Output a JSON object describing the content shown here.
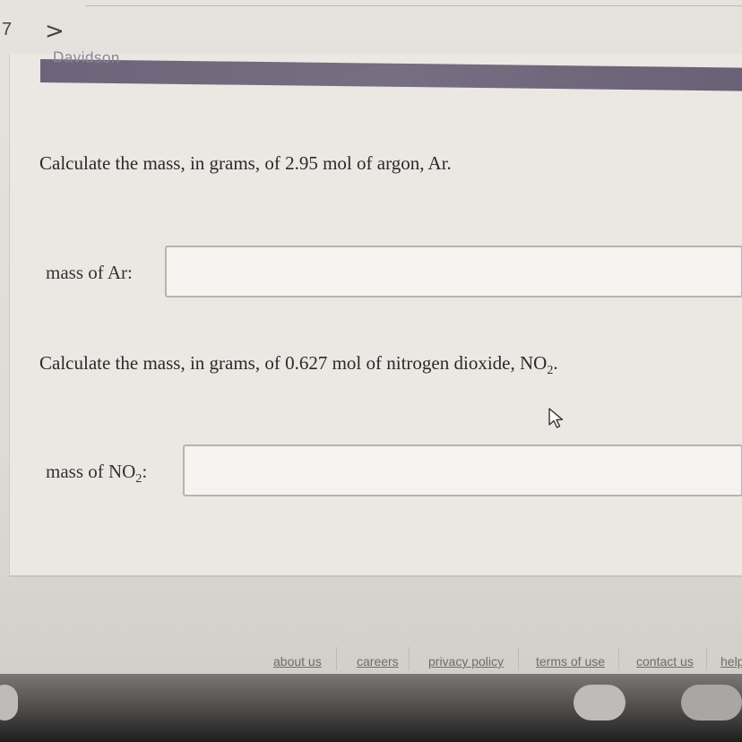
{
  "nav": {
    "question_number": "7",
    "next_arrow": ">"
  },
  "banner": {
    "label": "Davidson"
  },
  "questions": [
    {
      "prompt": "Calculate the mass, in grams, of 2.95 mol of argon, Ar.",
      "answer_label": "mass of Ar:",
      "value": ""
    },
    {
      "prompt_before": "Calculate the mass, in grams, of 0.627 mol of nitrogen dioxide, NO",
      "prompt_sub": "2",
      "prompt_after": ".",
      "answer_label_before": "mass of NO",
      "answer_label_sub": "2",
      "answer_label_after": ":",
      "value": ""
    }
  ],
  "footer": {
    "links": [
      "about us",
      "careers",
      "privacy policy",
      "terms of use",
      "contact us",
      "help"
    ]
  },
  "icons": {
    "next": "chevron-right-icon",
    "pointer": "mouse-pointer-icon"
  }
}
